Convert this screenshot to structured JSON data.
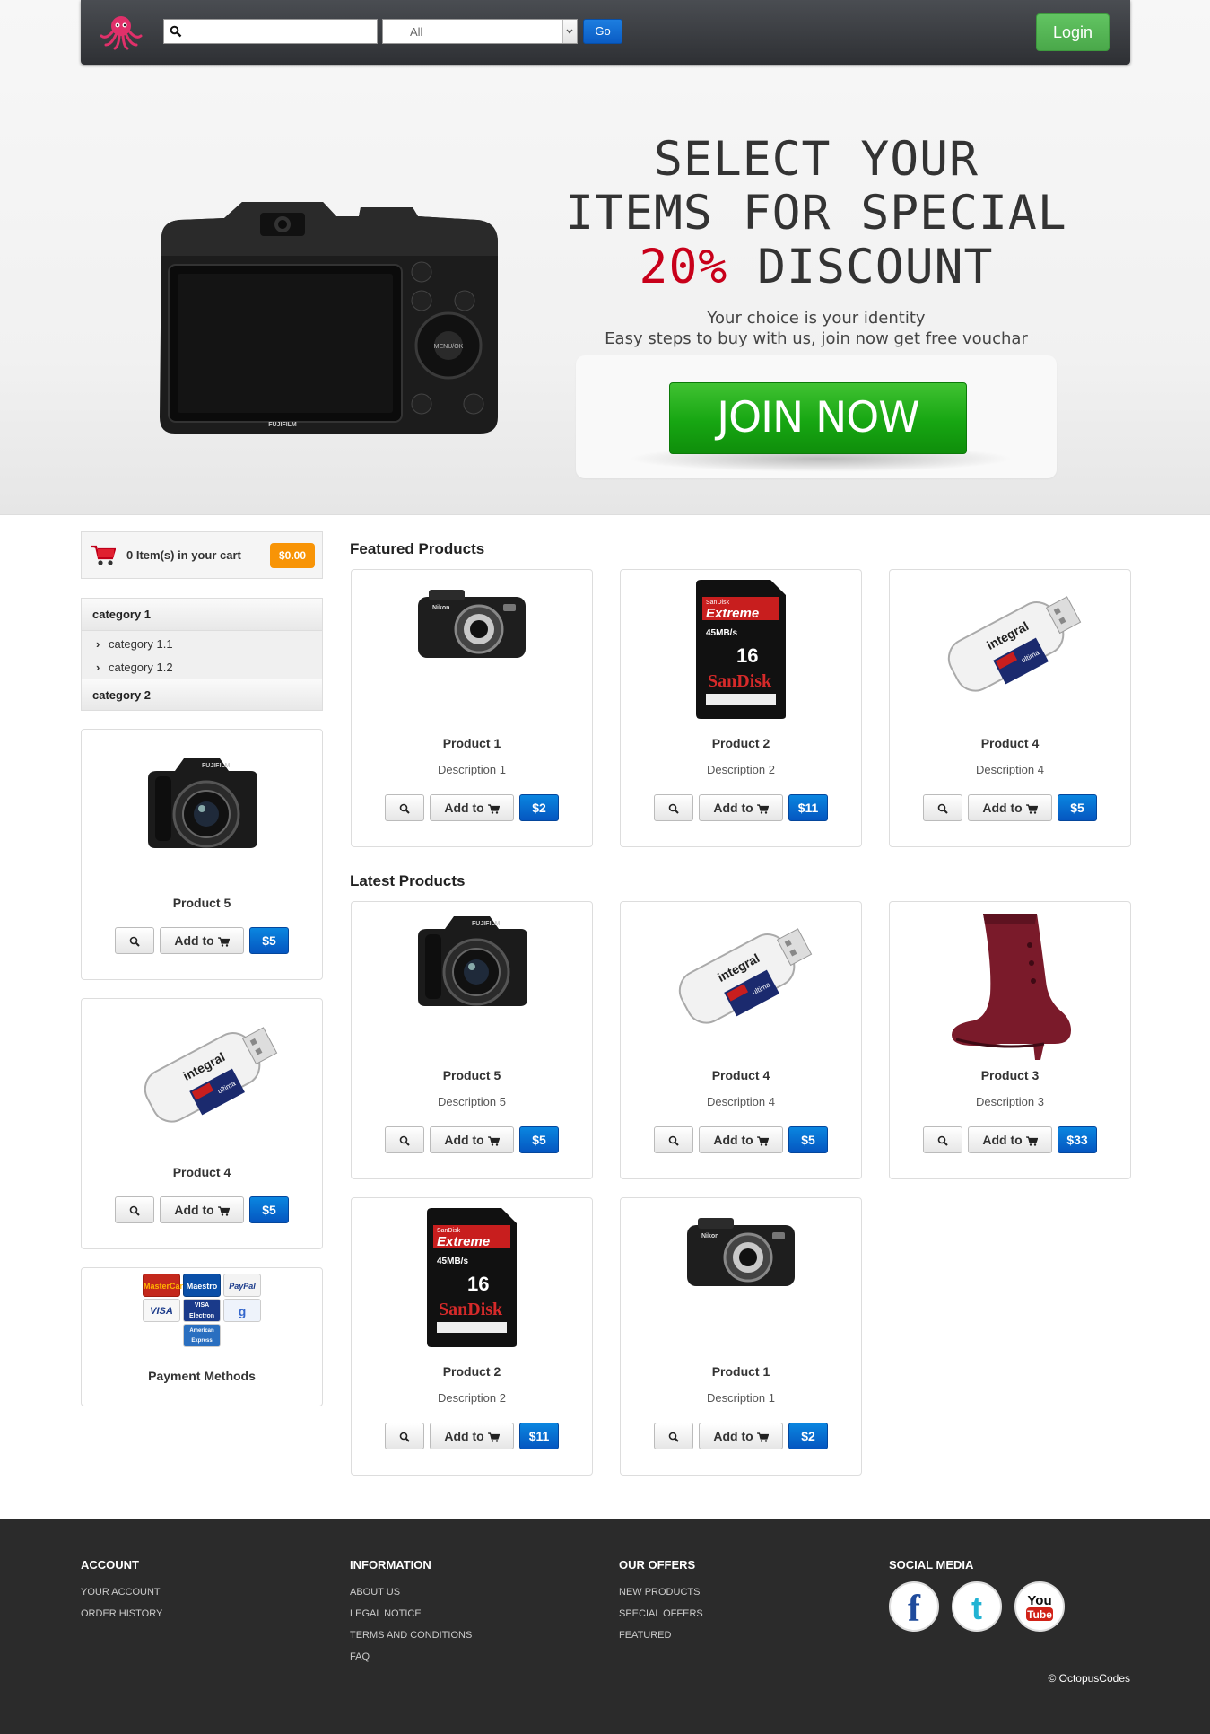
{
  "header": {
    "search_placeholder": "",
    "category_value": "All",
    "go_label": "Go",
    "login_label": "Login"
  },
  "hero": {
    "headline_1": "SELECT YOUR",
    "headline_2": "ITEMS FOR SPECIAL",
    "discount": "20%",
    "discount_word": " DISCOUNT",
    "tagline_1": "Your choice is your identity",
    "tagline_2": "Easy steps to buy with us, join now get free vouchar",
    "join_label": "JOIN NOW",
    "accent_color": "#c8001a"
  },
  "cart": {
    "text": "0 Item(s) in your cart",
    "total": "$0.00"
  },
  "categories": [
    {
      "label": "category 1",
      "children": [
        "category 1.1",
        "category 1.2"
      ]
    },
    {
      "label": "category 2"
    }
  ],
  "sidebar_products": [
    {
      "name": "Product 5",
      "add_label": "Add to",
      "price": "$5",
      "image": "dslr-camera"
    },
    {
      "name": "Product 4",
      "add_label": "Add to",
      "price": "$5",
      "image": "card-reader"
    }
  ],
  "payment": {
    "label": "Payment Methods",
    "logos": [
      "MasterCard",
      "Maestro",
      "PayPal",
      "VISA",
      "VISA Electron",
      "Google",
      "American Express"
    ]
  },
  "featured": {
    "title": "Featured Products",
    "items": [
      {
        "name": "Product 1",
        "desc_label": "Description",
        "desc_num": "1",
        "add_label": "Add to",
        "price": "$2",
        "image": "compact-camera"
      },
      {
        "name": "Product 2",
        "desc_label": "Description",
        "desc_num": "2",
        "add_label": "Add to",
        "price": "$11",
        "image": "sd-card"
      },
      {
        "name": "Product 4",
        "desc_label": "Description",
        "desc_num": "4",
        "add_label": "Add to",
        "price": "$5",
        "image": "card-reader"
      }
    ]
  },
  "latest": {
    "title": "Latest Products",
    "items": [
      {
        "name": "Product 5",
        "desc_label": "Description",
        "desc_num": "5",
        "add_label": "Add to",
        "price": "$5",
        "image": "dslr-camera"
      },
      {
        "name": "Product 4",
        "desc_label": "Description",
        "desc_num": "4",
        "add_label": "Add to",
        "price": "$5",
        "image": "card-reader"
      },
      {
        "name": "Product 3",
        "desc_label": "Description",
        "desc_num": "3",
        "add_label": "Add to",
        "price": "$33",
        "image": "boot"
      },
      {
        "name": "Product 2",
        "desc_label": "Description",
        "desc_num": "2",
        "add_label": "Add to",
        "price": "$11",
        "image": "sd-card"
      },
      {
        "name": "Product 1",
        "desc_label": "Description",
        "desc_num": "1",
        "add_label": "Add to",
        "price": "$2",
        "image": "compact-camera"
      }
    ]
  },
  "footer": {
    "account": {
      "title": "ACCOUNT",
      "links": [
        "YOUR ACCOUNT",
        "ORDER HISTORY"
      ]
    },
    "information": {
      "title": "INFORMATION",
      "links": [
        "ABOUT US",
        "LEGAL NOTICE",
        "TERMS AND CONDITIONS",
        "FAQ"
      ]
    },
    "offers": {
      "title": "OUR OFFERS",
      "links": [
        "NEW PRODUCTS",
        "SPECIAL OFFERS",
        "FEATURED"
      ]
    },
    "social": {
      "title": "SOCIAL MEDIA",
      "icons": [
        "facebook-icon",
        "twitter-icon",
        "youtube-icon"
      ]
    },
    "copyright": "© OctopusCodes"
  }
}
